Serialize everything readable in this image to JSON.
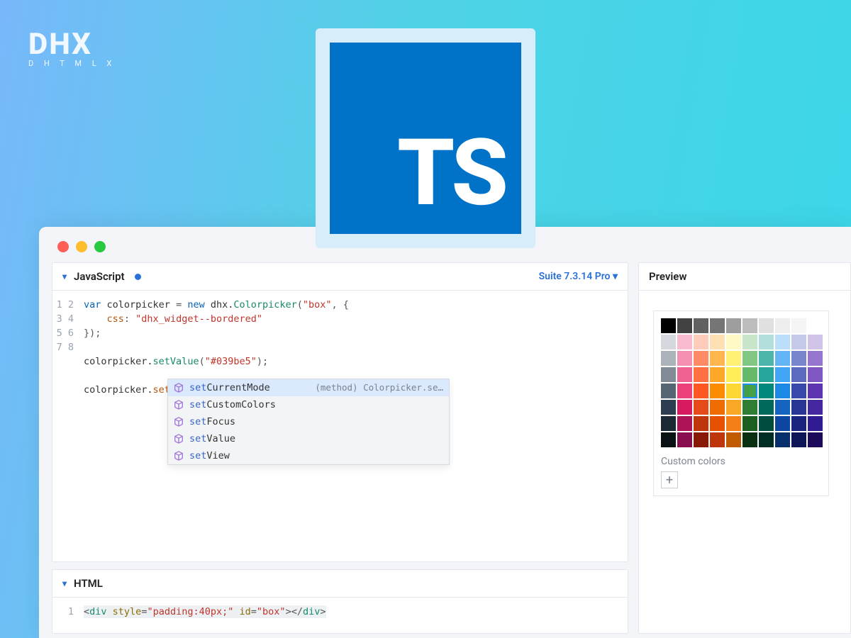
{
  "logo": {
    "big": "DHX",
    "small": "D H T M L X"
  },
  "ts_badge": "TS",
  "panels": {
    "js": {
      "title": "JavaScript",
      "modified": true,
      "suite_label": "Suite 7.3.14 Pro"
    },
    "html": {
      "title": "HTML"
    },
    "preview": {
      "title": "Preview"
    }
  },
  "code_js": {
    "lines": [
      "1",
      "2",
      "3",
      "4",
      "5",
      "6",
      "7",
      "8"
    ],
    "l1_kw": "var",
    "l1_id": " colorpicker ",
    "l1_eq": "= ",
    "l1_new": "new",
    "l1_sp": " dhx.",
    "l1_cls": "Colorpicker",
    "l1_open": "(",
    "l1_arg1": "\"box\"",
    "l1_comma": ", {",
    "l2_pad": "    ",
    "l2_prop": "css",
    "l2_colon": ": ",
    "l2_val": "\"dhx_widget--bordered\"",
    "l3": "});",
    "l5_a": "colorpicker.",
    "l5_m": "setValue",
    "l5_open": "(",
    "l5_arg": "\"#039be5\"",
    "l5_close": ");",
    "l7_a": "colorpicker.",
    "l7_m": "set"
  },
  "autocomplete": {
    "hint": "(method) Colorpicker.se…",
    "items": [
      {
        "prefix": "set",
        "rest": "CurrentMode",
        "selected": true
      },
      {
        "prefix": "set",
        "rest": "CustomColors"
      },
      {
        "prefix": "set",
        "rest": "Focus"
      },
      {
        "prefix": "set",
        "rest": "Value"
      },
      {
        "prefix": "set",
        "rest": "View"
      }
    ]
  },
  "code_html": {
    "lines": [
      "1"
    ],
    "open": "<",
    "tag": "div",
    "sp": " ",
    "a1": "style",
    "eq1": "=",
    "v1": "\"padding:40px;\"",
    "sp2": " ",
    "a2": "id",
    "eq2": "=",
    "v2": "\"box\"",
    "close1": ">",
    "close2": "</",
    "tag2": "div",
    "close3": ">"
  },
  "colorpicker": {
    "custom_label": "Custom colors",
    "selected_index": 45,
    "swatches": [
      "#000000",
      "#424242",
      "#616161",
      "#757575",
      "#9e9e9e",
      "#bdbdbd",
      "#e0e0e0",
      "#eeeeee",
      "#f5f5f5",
      "#ffffff",
      "#d5d8dc",
      "#f8bbd0",
      "#ffccbc",
      "#ffe0b2",
      "#fff9c4",
      "#c8e6c9",
      "#b2dfdb",
      "#bbdefb",
      "#c5cae9",
      "#d1c4e9",
      "#abb2b9",
      "#f48fb1",
      "#ff8a65",
      "#ffb74d",
      "#fff176",
      "#81c784",
      "#4db6ac",
      "#64b5f6",
      "#7986cb",
      "#9575cd",
      "#808b96",
      "#f06292",
      "#ff7043",
      "#ffa726",
      "#ffee58",
      "#66bb6a",
      "#26a69a",
      "#42a5f5",
      "#5c6bc0",
      "#7e57c2",
      "#566573",
      "#ec407a",
      "#ff5722",
      "#fb8c00",
      "#fdd835",
      "#43a047",
      "#00897b",
      "#1e88e5",
      "#3949ab",
      "#5e35b1",
      "#2c3e50",
      "#d81b60",
      "#e64a19",
      "#ef6c00",
      "#f9a825",
      "#2e7d32",
      "#00695c",
      "#1565c0",
      "#283593",
      "#4527a0",
      "#1c2833",
      "#ad1457",
      "#bf360c",
      "#e65100",
      "#f57f17",
      "#1b5e20",
      "#004d40",
      "#0d47a1",
      "#1a237e",
      "#311b92",
      "#0b1215",
      "#880e4f",
      "#871906",
      "#bf360c",
      "#c05b02",
      "#0a3012",
      "#002e25",
      "#072f6b",
      "#0f1559",
      "#1e0a5a"
    ]
  }
}
